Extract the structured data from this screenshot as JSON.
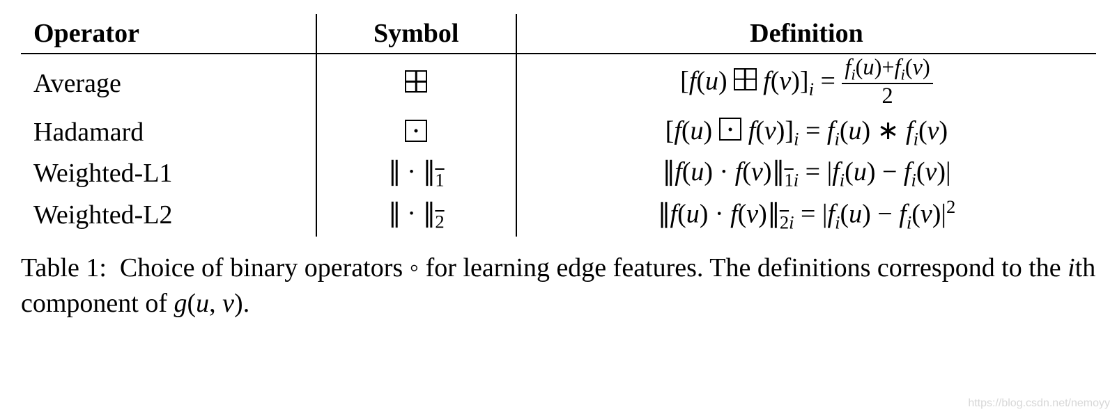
{
  "headers": {
    "c1": "Operator",
    "c2": "Symbol",
    "c3": "Definition"
  },
  "rows": [
    {
      "operator": "Average",
      "symbol_html": "<span class='op-box plus'></span>",
      "definition_html": "[<span class='ital'>f</span>(<span class='ital'>u</span>) <span class='op-box plus'></span> <span class='ital'>f</span>(<span class='ital'>v</span>)]<span class='sub ital'>i</span> = <span class='frac'><span class='num'><span class='ital'>f</span><span class='sub ital'>i</span>(<span class='ital'>u</span>)+<span class='ital'>f</span><span class='sub ital'>i</span>(<span class='ital'>v</span>)</span><span class='den'>2</span></span>"
    },
    {
      "operator": "Hadamard",
      "symbol_html": "<span class='op-box dot'></span>",
      "definition_html": "[<span class='ital'>f</span>(<span class='ital'>u</span>) <span class='op-box dot'></span> <span class='ital'>f</span>(<span class='ital'>v</span>)]<span class='sub ital'>i</span> = <span class='ital'>f</span><span class='sub ital'>i</span>(<span class='ital'>u</span>) ∗ <span class='ital'>f</span><span class='sub ital'>i</span>(<span class='ital'>v</span>)"
    },
    {
      "operator": "Weighted-L1",
      "symbol_html": "<span class='norm'>∥</span> · <span class='norm'>∥</span><span class='sub'><span class='barover'>1</span></span>",
      "definition_html": "<span class='norm'>∥</span><span class='ital'>f</span>(<span class='ital'>u</span>) · <span class='ital'>f</span>(<span class='ital'>v</span>)<span class='norm'>∥</span><span class='sub'><span class='barover'>1</span><span class='ital'>i</span></span> = |<span class='ital'>f</span><span class='sub ital'>i</span>(<span class='ital'>u</span>) − <span class='ital'>f</span><span class='sub ital'>i</span>(<span class='ital'>v</span>)|"
    },
    {
      "operator": "Weighted-L2",
      "symbol_html": "<span class='norm'>∥</span> · <span class='norm'>∥</span><span class='sub'><span class='barover'>2</span></span>",
      "definition_html": "<span class='norm'>∥</span><span class='ital'>f</span>(<span class='ital'>u</span>) · <span class='ital'>f</span>(<span class='ital'>v</span>)<span class='norm'>∥</span><span class='sub'><span class='barover'>2</span><span class='ital'>i</span></span> = |<span class='ital'>f</span><span class='sub ital'>i</span>(<span class='ital'>u</span>) − <span class='ital'>f</span><span class='sub ital'>i</span>(<span class='ital'>v</span>)|<span class='sup'>2</span>"
    }
  ],
  "caption_html": "Table 1:&nbsp; Choice of binary operators ◦ for learning edge features. The definitions correspond to the <span class='ital'>i</span>th component of <span class='ital'>g</span>(<span class='ital'>u</span>, <span class='ital'>v</span>).",
  "watermark": "https://blog.csdn.net/nemoyy",
  "chart_data": {
    "type": "table",
    "title": "Table 1: Choice of binary operators ∘ for learning edge features. The definitions correspond to the ith component of g(u, v).",
    "columns": [
      "Operator",
      "Symbol",
      "Definition"
    ],
    "rows": [
      [
        "Average",
        "⊞",
        "[f(u) ⊞ f(v)]_i = (f_i(u) + f_i(v)) / 2"
      ],
      [
        "Hadamard",
        "⊡",
        "[f(u) ⊡ f(v)]_i = f_i(u) * f_i(v)"
      ],
      [
        "Weighted-L1",
        "‖·‖_1̄",
        "‖f(u) · f(v)‖_{1̄ i} = |f_i(u) − f_i(v)|"
      ],
      [
        "Weighted-L2",
        "‖·‖_2̄",
        "‖f(u) · f(v)‖_{2̄ i} = |f_i(u) − f_i(v)|^2"
      ]
    ]
  }
}
